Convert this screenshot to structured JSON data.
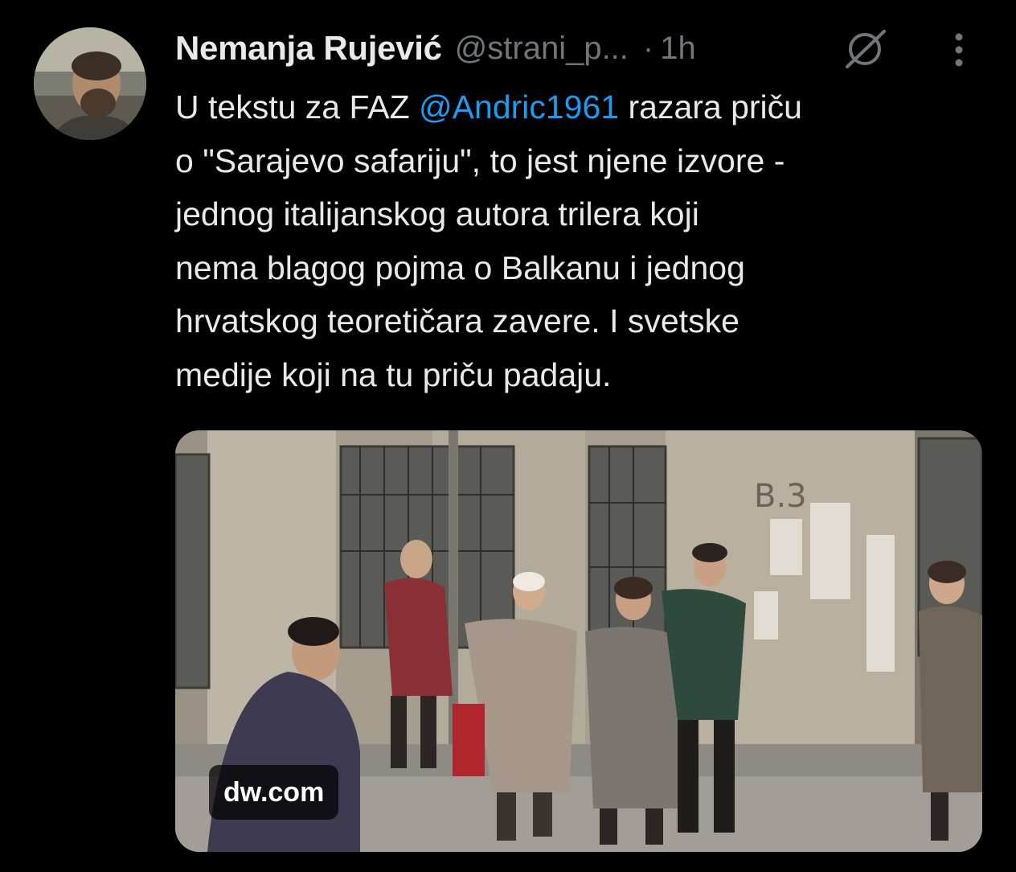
{
  "tweet": {
    "author": {
      "display_name": "Nemanja Rujević",
      "handle": "@strani_p...",
      "avatar_icon": "profile-photo"
    },
    "separator": "·",
    "timestamp": "1h",
    "text_lines": [
      {
        "before": "U tekstu za FAZ ",
        "mention": "@Andric1961",
        "after": " razara priču"
      },
      {
        "text": "o \"Sarajevo safariju\", to jest njene izvore -"
      },
      {
        "text": "jednog italijanskog autora trilera koji"
      },
      {
        "text": "nema blagog pojma o Balkanu i jednog"
      },
      {
        "text": "hrvatskog teoretičara zavere. I svetske"
      },
      {
        "text": "medije koji na tu priču padaju."
      }
    ],
    "media": {
      "domain": "dw.com",
      "image_icon": "link-preview-photo"
    },
    "actions": {
      "grok_icon": "grok-icon",
      "more_icon": "more-options-icon"
    }
  },
  "colors": {
    "background": "#000000",
    "primary_text": "#e7e9ea",
    "secondary_text": "#71767b",
    "link": "#1d9bf0"
  }
}
